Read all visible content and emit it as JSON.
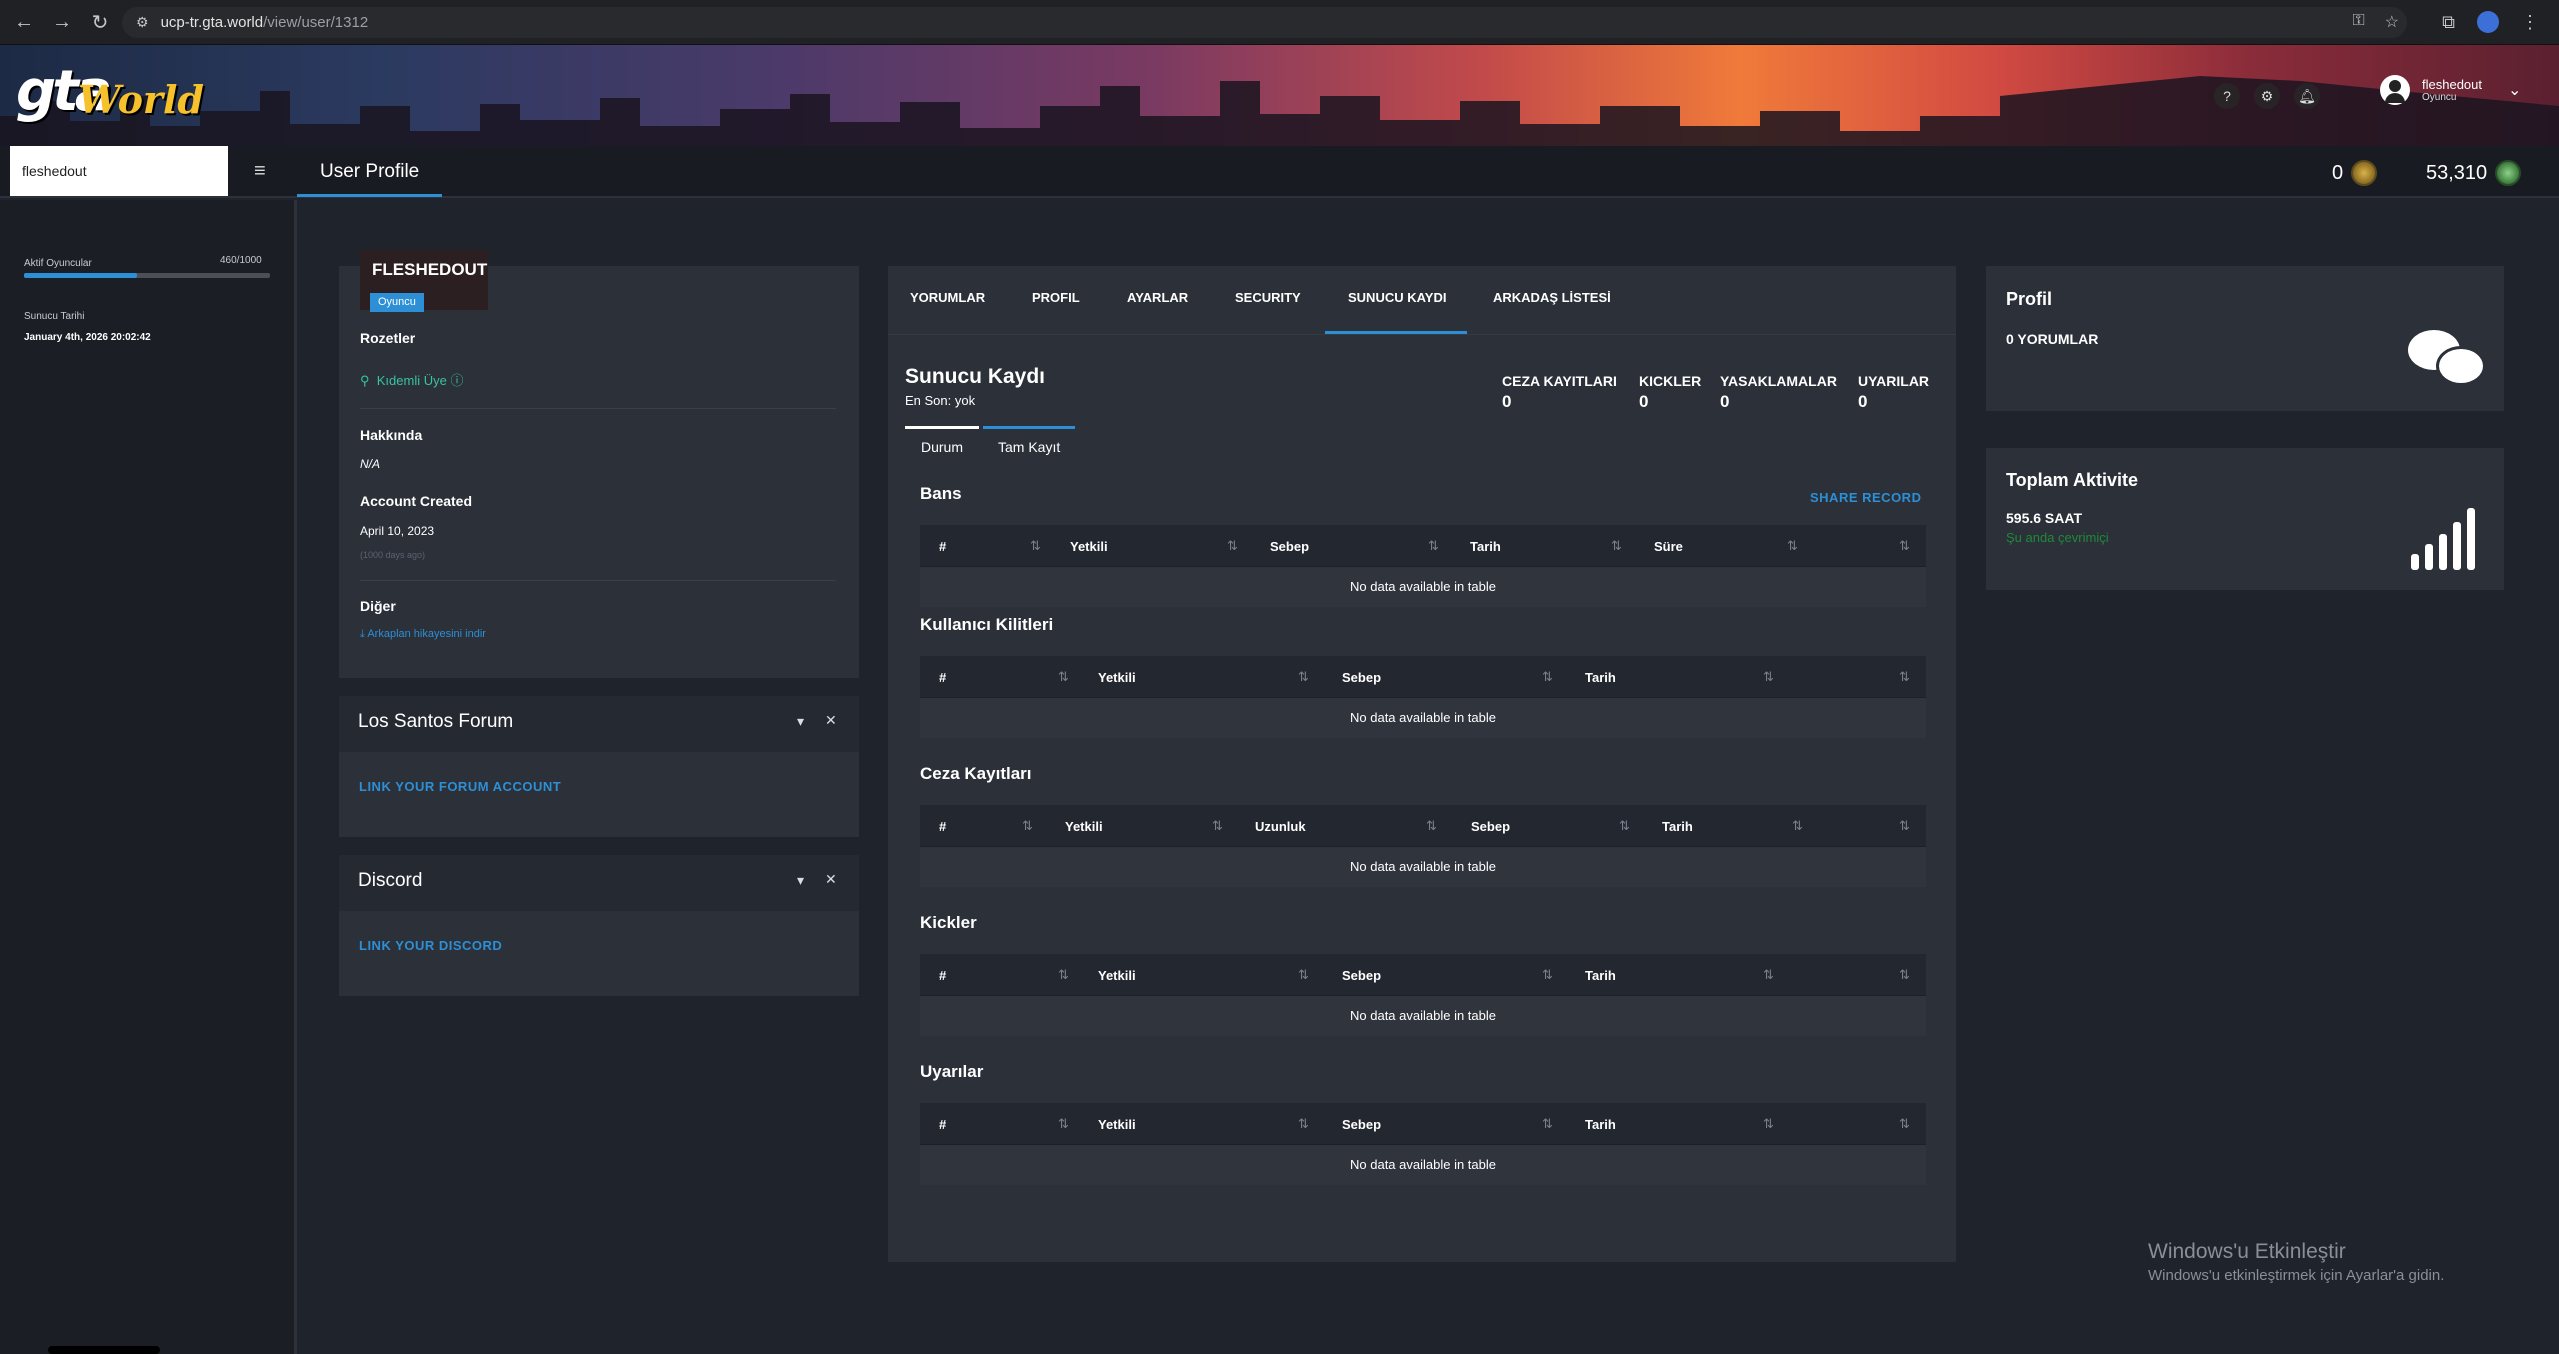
{
  "browser": {
    "url_host": "ucp-tr.gta.world",
    "url_path": "/view/user/1312"
  },
  "logo": {
    "gta": "gta",
    "world": "World"
  },
  "header_user": {
    "name": "fleshedout",
    "role": "Oyuncu"
  },
  "topbar": {
    "search_value": "fleshedout",
    "page_title": "User Profile",
    "counter1": "0",
    "counter2": "53,310"
  },
  "sidebar": {
    "active_players_label": "Aktif Oyuncular",
    "active_players_value": "460/1000",
    "active_players_fraction": 0.46,
    "server_date_label": "Sunucu Tarihi",
    "server_date_value": "January 4th, 2026 20:02:42"
  },
  "profile": {
    "name": "FLESHEDOUT",
    "role": "Oyuncu",
    "badges_title": "Rozetler",
    "badge": "Kıdemli Üye",
    "about_title": "Hakkında",
    "about_value": "N/A",
    "created_title": "Account Created",
    "created_value": "April 10, 2023",
    "created_ago": "(1000 days ago)",
    "other_title": "Diğer",
    "other_link": "Arkaplan hikayesini indir"
  },
  "forum_widget": {
    "title": "Los Santos Forum",
    "link": "LINK YOUR FORUM ACCOUNT"
  },
  "discord_widget": {
    "title": "Discord",
    "link": "LINK YOUR DISCORD"
  },
  "tabs": [
    "YORUMLAR",
    "PROFIL",
    "AYARLAR",
    "SECURITY",
    "SUNUCU KAYDI",
    "ARKADAŞ LİSTESİ"
  ],
  "server_log": {
    "title": "Sunucu Kaydı",
    "last": "En Son: yok",
    "stats": [
      {
        "label": "CEZA KAYITLARI",
        "value": "0"
      },
      {
        "label": "KICKLER",
        "value": "0"
      },
      {
        "label": "YASAKLAMALAR",
        "value": "0"
      },
      {
        "label": "UYARILAR",
        "value": "0"
      }
    ],
    "subtabs": [
      "Durum",
      "Tam Kayıt"
    ],
    "share": "SHARE RECORD",
    "empty": "No data available in table",
    "sections": [
      {
        "title": "Bans",
        "columns": [
          "#",
          "Yetkili",
          "Sebep",
          "Tarih",
          "Süre"
        ]
      },
      {
        "title": "Kullanıcı Kilitleri",
        "columns": [
          "#",
          "Yetkili",
          "Sebep",
          "Tarih"
        ]
      },
      {
        "title": "Ceza Kayıtları",
        "columns": [
          "#",
          "Yetkili",
          "Uzunluk",
          "Sebep",
          "Tarih"
        ]
      },
      {
        "title": "Kickler",
        "columns": [
          "#",
          "Yetkili",
          "Sebep",
          "Tarih"
        ]
      },
      {
        "title": "Uyarılar",
        "columns": [
          "#",
          "Yetkili",
          "Sebep",
          "Tarih"
        ]
      }
    ]
  },
  "right": {
    "profile_title": "Profil",
    "comments": "0 YORUMLAR",
    "activity_title": "Toplam Aktivite",
    "hours": "595.6 SAAT",
    "online": "Şu anda çevrimiçi"
  },
  "windows": {
    "title": "Windows'u Etkinleştir",
    "sub": "Windows'u etkinleştirmek için Ayarlar'a gidin."
  },
  "colors": {
    "accent": "#2d8fd5",
    "green": "#39c3a2",
    "bg": "#1f232b",
    "card": "#2b3039"
  }
}
